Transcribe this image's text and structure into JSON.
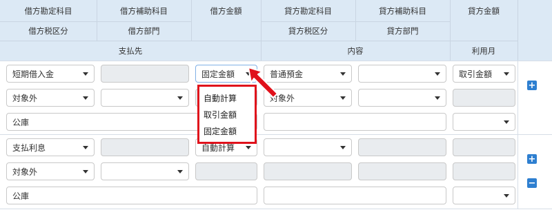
{
  "header": {
    "debit_account": "借方勘定科目",
    "debit_sub_account": "借方補助科目",
    "debit_amount": "借方金額",
    "credit_account": "貸方勘定科目",
    "credit_sub_account": "貸方補助科目",
    "credit_amount": "貸方金額",
    "debit_tax_category": "借方税区分",
    "debit_department": "借方部門",
    "credit_tax_category": "貸方税区分",
    "credit_department": "貸方部門",
    "payee": "支払先",
    "content": "内容",
    "usage_month": "利用月"
  },
  "rows": [
    {
      "debit_account": "短期借入金",
      "debit_sub_account": "",
      "debit_amount": "固定金額",
      "credit_account": "普通預金",
      "credit_sub_account": "",
      "credit_amount": "取引金額",
      "debit_tax": "対象外",
      "debit_department": "",
      "debit_amount_value": "",
      "credit_tax": "対象外",
      "credit_department": "",
      "credit_amount_value": "",
      "payee": "公庫",
      "content": "",
      "usage_month": ""
    },
    {
      "debit_account": "支払利息",
      "debit_sub_account": "",
      "debit_amount": "自動計算",
      "credit_account": "",
      "credit_sub_account": "",
      "credit_amount": "",
      "debit_tax": "対象外",
      "debit_department": "",
      "payee": "公庫",
      "content": "",
      "usage_month": ""
    }
  ],
  "dropdown": {
    "options": [
      "自動計算",
      "取引金額",
      "固定金額"
    ]
  },
  "buttons": {
    "add": "+",
    "remove": "−"
  },
  "colors": {
    "header_bg": "#dce9f5",
    "accent_blue": "#2e7fd0",
    "highlight_red": "#e0111b"
  }
}
